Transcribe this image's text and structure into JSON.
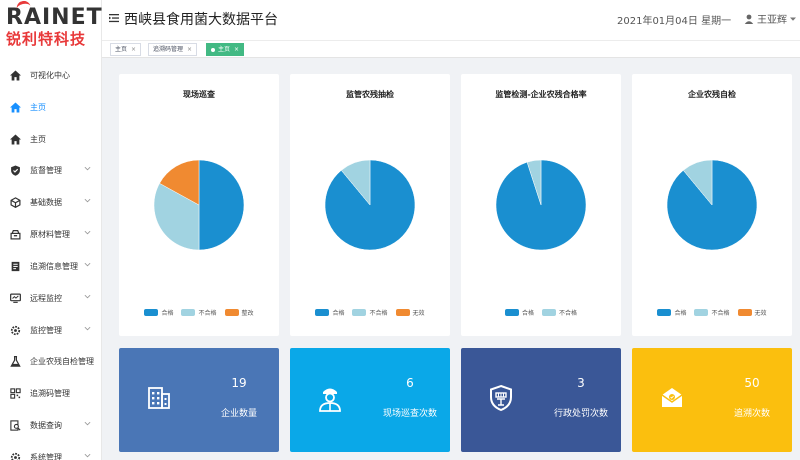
{
  "app": {
    "logo_en": "RAINET",
    "logo_cn": "锐利特科技",
    "title": "西峡县食用菌大数据平台",
    "date": "2021年01月04日 星期一",
    "user": "王亚辉"
  },
  "sidebar": {
    "items": [
      {
        "label": "可视化中心",
        "icon": "home-icon",
        "active": false,
        "chevron": false
      },
      {
        "label": "主页",
        "icon": "home-icon",
        "active": true,
        "chevron": false
      },
      {
        "label": "主页",
        "icon": "home-icon",
        "active": false,
        "chevron": false
      },
      {
        "label": "监督管理",
        "icon": "shield-icon",
        "active": false,
        "chevron": true
      },
      {
        "label": "基础数据",
        "icon": "cube-icon",
        "active": false,
        "chevron": true
      },
      {
        "label": "原材料管理",
        "icon": "box-icon",
        "active": false,
        "chevron": true
      },
      {
        "label": "追溯信息管理",
        "icon": "document-icon",
        "active": false,
        "chevron": true
      },
      {
        "label": "远程监控",
        "icon": "monitor-icon",
        "active": false,
        "chevron": true
      },
      {
        "label": "监控管理",
        "icon": "gear-icon",
        "active": false,
        "chevron": true
      },
      {
        "label": "企业农残自检管理",
        "icon": "flask-icon",
        "active": false,
        "chevron": false
      },
      {
        "label": "追溯码管理",
        "icon": "qrcode-icon",
        "active": false,
        "chevron": false
      },
      {
        "label": "数据查询",
        "icon": "search-doc-icon",
        "active": false,
        "chevron": true
      },
      {
        "label": "系统管理",
        "icon": "gear-icon",
        "active": false,
        "chevron": true
      }
    ]
  },
  "tabs": [
    {
      "label": "主页",
      "active": false
    },
    {
      "label": "追溯码管理",
      "active": false
    },
    {
      "label": "主页",
      "active": true
    }
  ],
  "colors": {
    "pass": "#1a8fd0",
    "fail": "#a1d3e1",
    "rectify": "#f08a31",
    "invalid": "#f08a31",
    "stat1": "#4a76b6",
    "stat2": "#0aa8e8",
    "stat3": "#3a5797",
    "stat4": "#fbbf0e"
  },
  "chart_data": [
    {
      "type": "pie",
      "title": "现场巡查",
      "categories": [
        "合格",
        "不合格",
        "整改"
      ],
      "values": [
        50,
        33,
        17
      ],
      "colors": [
        "#1a8fd0",
        "#a1d3e1",
        "#f08a31"
      ]
    },
    {
      "type": "pie",
      "title": "监管农残抽检",
      "categories": [
        "合格",
        "不合格",
        "无效"
      ],
      "values": [
        89,
        11,
        0
      ],
      "colors": [
        "#1a8fd0",
        "#a1d3e1",
        "#f08a31"
      ]
    },
    {
      "type": "pie",
      "title": "监管检测-企业农残合格率",
      "categories": [
        "合格",
        "不合格"
      ],
      "values": [
        95,
        5
      ],
      "colors": [
        "#1a8fd0",
        "#a1d3e1"
      ]
    },
    {
      "type": "pie",
      "title": "企业农残自检",
      "categories": [
        "合格",
        "不合格",
        "无效"
      ],
      "values": [
        89,
        11,
        0
      ],
      "colors": [
        "#1a8fd0",
        "#a1d3e1",
        "#f08a31"
      ]
    }
  ],
  "stats": [
    {
      "value": "19",
      "label": "企业数量",
      "icon": "building-icon"
    },
    {
      "value": "6",
      "label": "现场巡查次数",
      "icon": "inspector-icon"
    },
    {
      "value": "3",
      "label": "行政处罚次数",
      "icon": "penalty-icon"
    },
    {
      "value": "50",
      "label": "追溯次数",
      "icon": "trace-mail-icon"
    }
  ]
}
